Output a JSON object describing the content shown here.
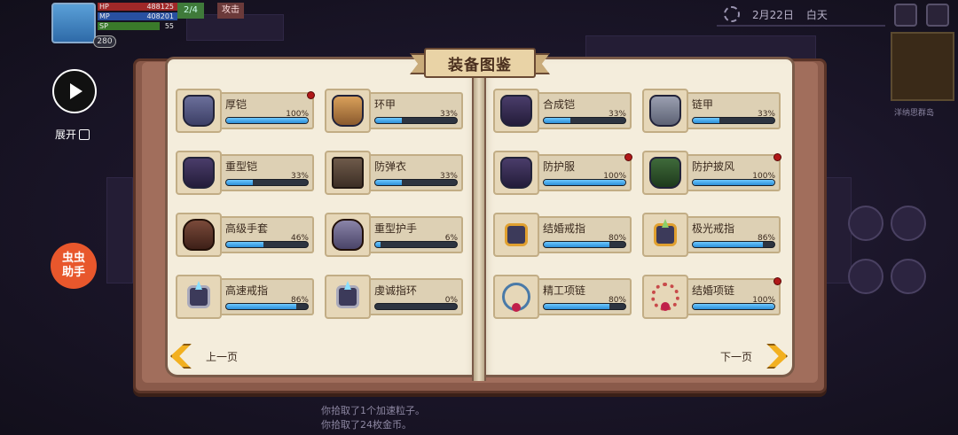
{
  "hud": {
    "hp_label": "HP",
    "hp_value": "488125",
    "mp_label": "MP",
    "mp_value": "408201",
    "sp_label": "SP",
    "sp_value": "55",
    "level": "280",
    "tag_one": "2/4",
    "tag_two": "攻击"
  },
  "date_bar": {
    "date": "2月22日",
    "time_of_day": "白天"
  },
  "minimap_label": "洋纳思群岛",
  "side": {
    "expand_label": "展开",
    "helper_label": "虫虫\n助手"
  },
  "book": {
    "title": "装备图鉴",
    "prev_label": "上一页",
    "next_label": "下一页",
    "left_items": [
      {
        "name": "厚铠",
        "percent": "100%",
        "progress": 1.0,
        "new": true,
        "icon": "heavy-armor-icon"
      },
      {
        "name": "环甲",
        "percent": "33%",
        "progress": 0.33,
        "new": false,
        "icon": "ring-armor-icon"
      },
      {
        "name": "重型铠",
        "percent": "33%",
        "progress": 0.33,
        "new": false,
        "icon": "heavy-plate-icon"
      },
      {
        "name": "防弹衣",
        "percent": "33%",
        "progress": 0.33,
        "new": false,
        "icon": "bulletproof-vest-icon"
      },
      {
        "name": "高级手套",
        "percent": "46%",
        "progress": 0.46,
        "new": false,
        "icon": "advanced-glove-icon"
      },
      {
        "name": "重型护手",
        "percent": "6%",
        "progress": 0.06,
        "new": false,
        "icon": "heavy-gauntlet-icon"
      },
      {
        "name": "高速戒指",
        "percent": "86%",
        "progress": 0.86,
        "new": false,
        "icon": "speed-ring-icon"
      },
      {
        "name": "虔诚指环",
        "percent": "0%",
        "progress": 0.0,
        "new": false,
        "icon": "devout-ring-icon"
      }
    ],
    "right_items": [
      {
        "name": "合成铠",
        "percent": "33%",
        "progress": 0.33,
        "new": false,
        "icon": "synthetic-armor-icon"
      },
      {
        "name": "链甲",
        "percent": "33%",
        "progress": 0.33,
        "new": false,
        "icon": "chainmail-icon"
      },
      {
        "name": "防护服",
        "percent": "100%",
        "progress": 1.0,
        "new": true,
        "icon": "protective-suit-icon"
      },
      {
        "name": "防护披风",
        "percent": "100%",
        "progress": 1.0,
        "new": true,
        "icon": "protective-cloak-icon"
      },
      {
        "name": "结婚戒指",
        "percent": "80%",
        "progress": 0.8,
        "new": false,
        "icon": "wedding-ring-icon"
      },
      {
        "name": "极光戒指",
        "percent": "86%",
        "progress": 0.86,
        "new": false,
        "icon": "aurora-ring-icon"
      },
      {
        "name": "精工项链",
        "percent": "80%",
        "progress": 0.8,
        "new": false,
        "icon": "crafted-necklace-icon"
      },
      {
        "name": "结婚项链",
        "percent": "100%",
        "progress": 1.0,
        "new": true,
        "icon": "wedding-necklace-icon"
      }
    ]
  },
  "log": [
    "你拾取了1个加速粒子。",
    "你拾取了24枚金币。"
  ],
  "colors": {
    "progress_fill": "#2b8fd8",
    "new_dot": "#b01818",
    "nav_arrow": "#f2b020",
    "helper": "#e8572c"
  }
}
